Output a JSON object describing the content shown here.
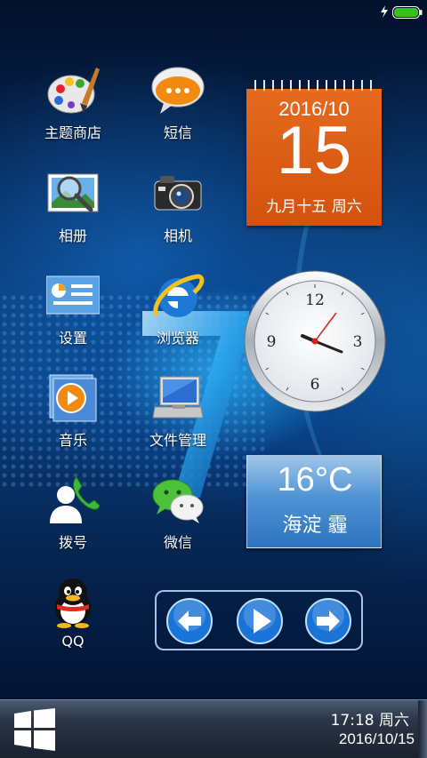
{
  "status_bar": {
    "charging_icon": "lightning-icon",
    "battery_icon": "battery-full-icon",
    "battery_color": "#34c21a"
  },
  "apps": [
    {
      "label": "主题商店",
      "icon": "palette-icon"
    },
    {
      "label": "短信",
      "icon": "chat-bubble-icon"
    },
    {
      "label": "相册",
      "icon": "photo-magnifier-icon"
    },
    {
      "label": "相机",
      "icon": "camera-icon"
    },
    {
      "label": "设置",
      "icon": "settings-panel-icon"
    },
    {
      "label": "浏览器",
      "icon": "internet-explorer-icon"
    },
    {
      "label": "音乐",
      "icon": "music-play-icon"
    },
    {
      "label": "文件管理",
      "icon": "computer-folder-icon"
    },
    {
      "label": "拨号",
      "icon": "phone-contact-icon"
    },
    {
      "label": "微信",
      "icon": "wechat-icon"
    },
    {
      "label": "QQ",
      "icon": "qq-penguin-icon"
    }
  ],
  "calendar": {
    "year_month": "2016/10",
    "day": "15",
    "lunar": "九月十五 周六",
    "color": "#d9581a"
  },
  "clock": {
    "numerals": [
      "12",
      "3",
      "6",
      "9"
    ]
  },
  "weather": {
    "temperature": "16°C",
    "place": "海淀 霾"
  },
  "media": {
    "buttons": [
      "previous-arrow-icon",
      "play-icon",
      "next-arrow-icon"
    ],
    "accent": "#1a73d6"
  },
  "taskbar": {
    "start_icon": "windows-logo-icon",
    "time": "17:18 周六",
    "date": "2016/10/15"
  }
}
